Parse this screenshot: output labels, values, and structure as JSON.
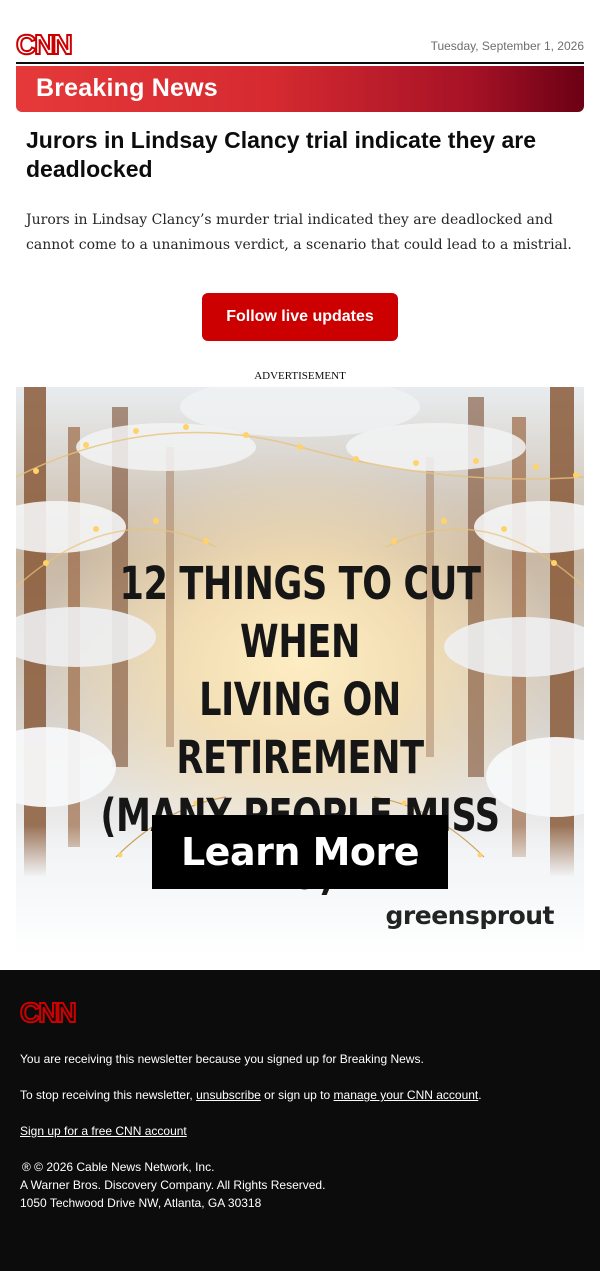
{
  "header": {
    "logo": "CNN",
    "date": "Tuesday, September 1, 2026"
  },
  "banner": {
    "label": "Breaking News",
    "gradient": [
      "#e5393a",
      "#6b0014"
    ]
  },
  "story": {
    "headline": "Jurors in Lindsay Clancy trial indicate they are deadlocked",
    "summary": "Jurors in Lindsay Clancy’s murder trial indicated they are deadlocked and cannot come to a unanimous verdict, a scenario that could lead to a mistrial.",
    "cta_label": "Follow live updates",
    "cta_color": "#cc0000"
  },
  "ad": {
    "label": "ADVERTISEMENT",
    "headline_lines": [
      "12 THINGS TO CUT WHEN",
      "LIVING ON RETIREMENT",
      "(MANY PEOPLE MISS #9)"
    ],
    "button_label": "Learn More",
    "brand": "greensprout"
  },
  "footer": {
    "logo": "CNN",
    "notice": "You are receiving this newsletter because you signed up for Breaking News.",
    "stop_prefix": "To stop receiving this newsletter, ",
    "unsubscribe_label": "unsubscribe",
    "stop_middle": " or sign up to ",
    "manage_label": "manage your CNN account",
    "stop_suffix": ".",
    "signup_label": "Sign up for a free CNN account",
    "copyright": "® © 2026 Cable News Network, Inc.",
    "company": "A Warner Bros. Discovery Company. All Rights Reserved.",
    "address": "1050 Techwood Drive NW, Atlanta, GA 30318"
  }
}
